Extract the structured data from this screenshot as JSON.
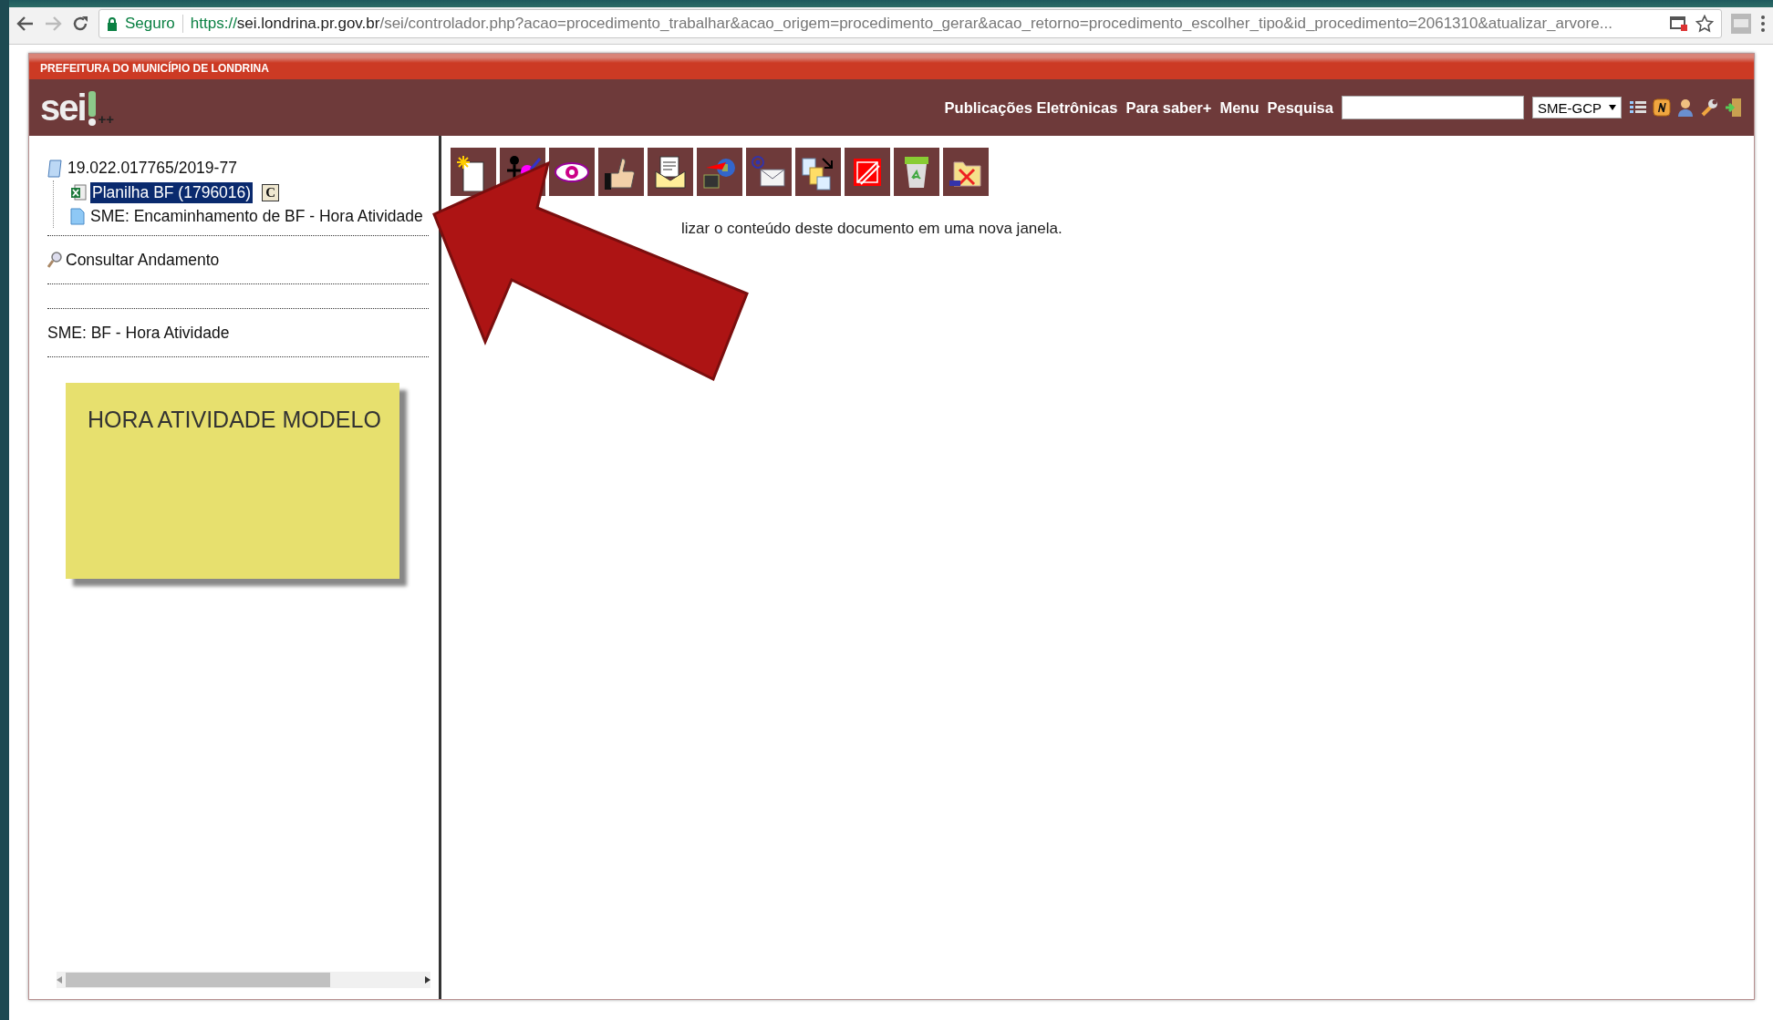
{
  "browser": {
    "security_label": "Seguro",
    "url_scheme": "https://",
    "url_host": "sei.londrina.pr.gov.br",
    "url_path": "/sei/controlador.php?acao=procedimento_trabalhar&acao_origem=procedimento_gerar&acao_retorno=procedimento_escolher_tipo&id_procedimento=2061310&atualizar_arvore..."
  },
  "header": {
    "org": "PREFEITURA DO MUNICÍPIO DE LONDRINA",
    "logo": "sei",
    "logo_suffix": "++",
    "nav": [
      "Publicações Eletrônicas",
      "Para saber+",
      "Menu",
      "Pesquisa"
    ],
    "unit": "SME-GCP"
  },
  "tree": {
    "label": "19.022.017765/2019-77",
    "children": [
      {
        "label": "Planilha BF (1796016)",
        "kind": "spreadsheet",
        "selected": true,
        "badge": "C"
      },
      {
        "label": "SME: Encaminhamento de BF - Hora Atividade",
        "kind": "document",
        "selected": false
      }
    ]
  },
  "consult_link": "Consultar Andamento",
  "process_type": "SME: BF - Hora Atividade",
  "note": "HORA ATIVIDADE MODELO",
  "toolbar_hint": "lizar o conteúdo deste documento em uma nova janela."
}
